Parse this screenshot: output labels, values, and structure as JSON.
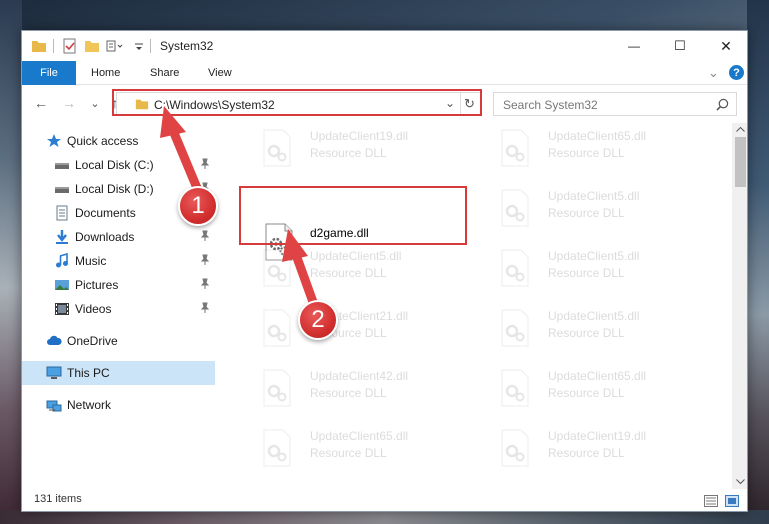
{
  "window": {
    "title": "System32",
    "minimize_glyph": "—",
    "maximize_glyph": "☐",
    "close_glyph": "✕"
  },
  "ribbon": {
    "tabs": [
      "File",
      "Home",
      "Share",
      "View"
    ],
    "collapse_glyph": "⌄",
    "help_glyph": "?"
  },
  "address_bar": {
    "path": "C:\\Windows\\System32",
    "back_glyph": "←",
    "forward_glyph": "→",
    "recent_glyph": "⌄",
    "up_glyph": "↑",
    "dropdown_glyph": "⌄",
    "refresh_glyph": "↻"
  },
  "search": {
    "placeholder": "Search System32"
  },
  "nav_pane": {
    "items": [
      {
        "label": "Quick access",
        "icon": "star-icon",
        "pinned": false
      },
      {
        "label": "Local Disk (C:)",
        "icon": "drive-icon",
        "pinned": true
      },
      {
        "label": "Local Disk (D:)",
        "icon": "drive-icon",
        "pinned": true
      },
      {
        "label": "Documents",
        "icon": "documents-icon",
        "pinned": true
      },
      {
        "label": "Downloads",
        "icon": "download-icon",
        "pinned": true
      },
      {
        "label": "Music",
        "icon": "music-icon",
        "pinned": true
      },
      {
        "label": "Pictures",
        "icon": "pictures-icon",
        "pinned": true
      },
      {
        "label": "Videos",
        "icon": "videos-icon",
        "pinned": true
      },
      {
        "label": "OneDrive",
        "icon": "cloud-icon",
        "pinned": false
      },
      {
        "label": "This PC",
        "icon": "computer-icon",
        "pinned": false,
        "selected": true
      },
      {
        "label": "Network",
        "icon": "network-icon",
        "pinned": false
      }
    ]
  },
  "files": {
    "left": [
      {
        "name": "UpdateClient19.dll",
        "type": "Resource DLL"
      },
      {
        "name": "d2game.dll",
        "type": "",
        "highlighted": true
      },
      {
        "name": "UpdateClient5.dll",
        "type": "Resource DLL"
      },
      {
        "name": "UpdateClient21.dll",
        "type": "Resource DLL"
      },
      {
        "name": "UpdateClient42.dll",
        "type": "Resource DLL"
      },
      {
        "name": "UpdateClient65.dll",
        "type": "Resource DLL"
      }
    ],
    "right": [
      {
        "name": "UpdateClient65.dll",
        "type": "Resource DLL"
      },
      {
        "name": "UpdateClient5.dll",
        "type": "Resource DLL"
      },
      {
        "name": "UpdateClient5.dll",
        "type": "Resource DLL"
      },
      {
        "name": "UpdateClient5.dll",
        "type": "Resource DLL"
      },
      {
        "name": "UpdateClient65.dll",
        "type": "Resource DLL"
      },
      {
        "name": "UpdateClient19.dll",
        "type": "Resource DLL"
      }
    ]
  },
  "status_bar": {
    "item_count": "131 items"
  },
  "annotations": {
    "step1": "1",
    "step2": "2",
    "accent_color": "#d63a3a"
  },
  "colors": {
    "file_tab": "#1979ca",
    "selected_nav": "#cce4f7",
    "folder": "#e8b84a"
  }
}
